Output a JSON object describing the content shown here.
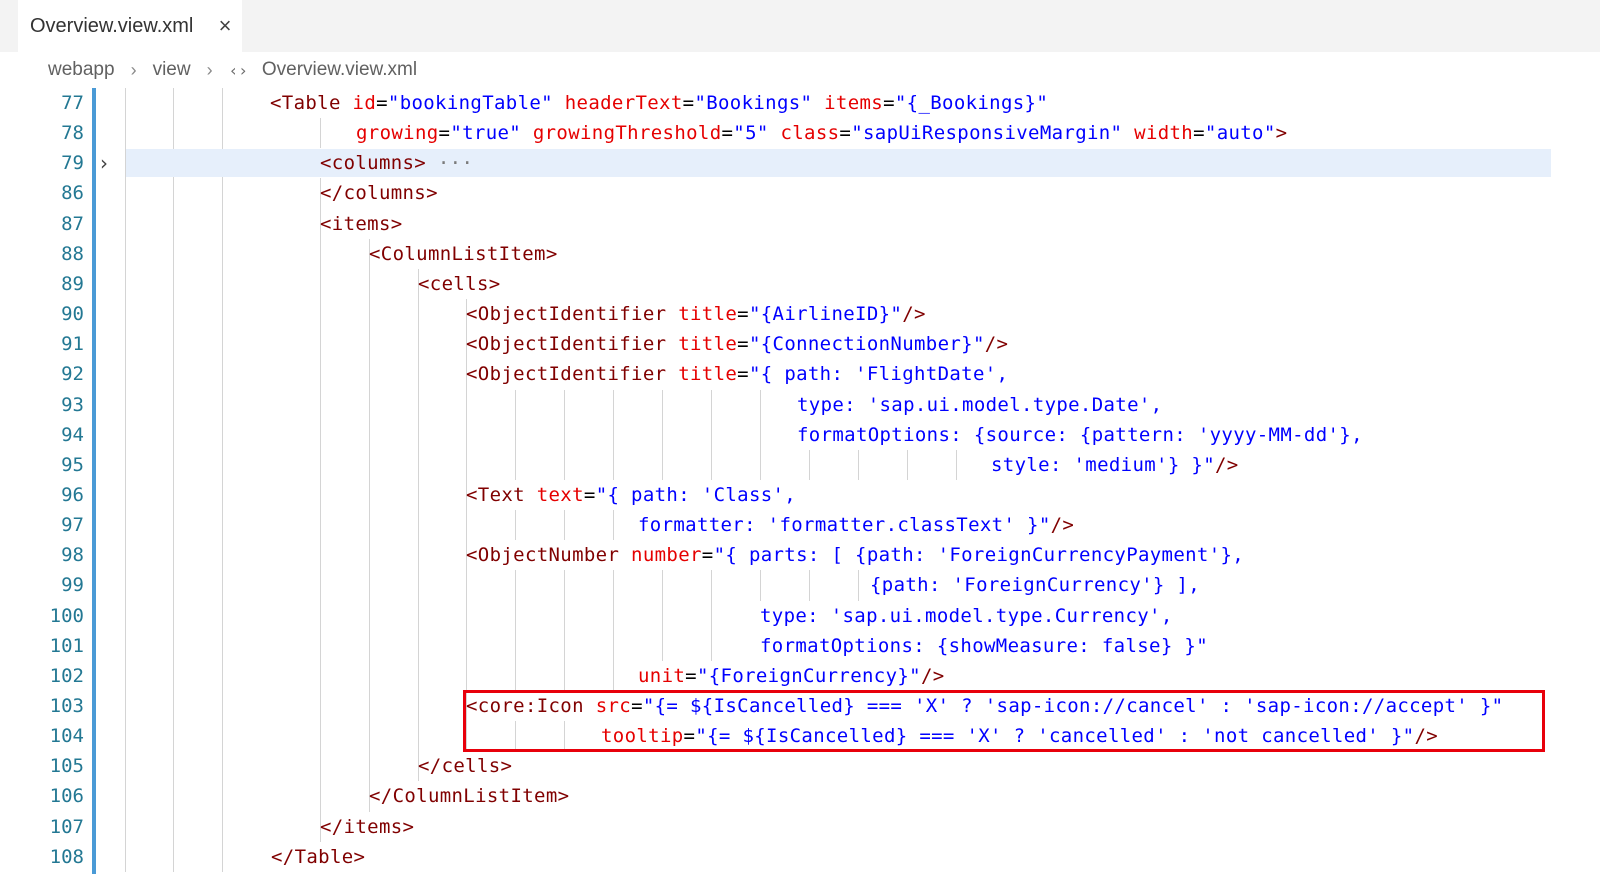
{
  "tab": {
    "title": "Overview.view.xml",
    "close_glyph": "×",
    "close_icon": "close-icon"
  },
  "breadcrumb": {
    "items": [
      "webapp",
      "view",
      "Overview.view.xml"
    ],
    "separator_glyph": "›",
    "file_icon": "xml-icon",
    "file_icon_glyph": "‹›"
  },
  "fold_glyph": "›",
  "colors": {
    "tag": "#800000",
    "attribute": "#e50000",
    "value": "#0000ff",
    "line_number": "#237893",
    "highlight_box": "#e8000b",
    "gutter_bar": "#4a9ad6"
  },
  "code_lines": [
    {
      "n": "77",
      "segs": [
        [
          "tag",
          "<Table "
        ],
        [
          "attr",
          "id"
        ],
        [
          "plain",
          "="
        ],
        [
          "val",
          "\"bookingTable\""
        ],
        [
          "plain",
          " "
        ],
        [
          "attr",
          "headerText"
        ],
        [
          "plain",
          "="
        ],
        [
          "val",
          "\"Bookings\""
        ],
        [
          "plain",
          " "
        ],
        [
          "attr",
          "items"
        ],
        [
          "plain",
          "="
        ],
        [
          "val",
          "\"{_Bookings}\""
        ]
      ]
    },
    {
      "n": "78",
      "segs": [
        [
          "attr",
          "growing"
        ],
        [
          "plain",
          "="
        ],
        [
          "val",
          "\"true\""
        ],
        [
          "plain",
          " "
        ],
        [
          "attr",
          "growingThreshold"
        ],
        [
          "plain",
          "="
        ],
        [
          "val",
          "\"5\""
        ],
        [
          "plain",
          " "
        ],
        [
          "attr",
          "class"
        ],
        [
          "plain",
          "="
        ],
        [
          "val",
          "\"sapUiResponsiveMargin\""
        ],
        [
          "plain",
          " "
        ],
        [
          "attr",
          "width"
        ],
        [
          "plain",
          "="
        ],
        [
          "val",
          "\"auto\""
        ],
        [
          "tag",
          ">"
        ]
      ]
    },
    {
      "n": "79",
      "segs": [
        [
          "tag",
          "<columns>"
        ],
        [
          "fold-dots",
          " ···"
        ]
      ]
    },
    {
      "n": "86",
      "segs": [
        [
          "tag",
          "</columns>"
        ]
      ]
    },
    {
      "n": "87",
      "segs": [
        [
          "tag",
          "<items>"
        ]
      ]
    },
    {
      "n": "88",
      "segs": [
        [
          "tag",
          "<ColumnListItem>"
        ]
      ]
    },
    {
      "n": "89",
      "segs": [
        [
          "tag",
          "<cells>"
        ]
      ]
    },
    {
      "n": "90",
      "segs": [
        [
          "tag",
          "<ObjectIdentifier "
        ],
        [
          "attr",
          "title"
        ],
        [
          "plain",
          "="
        ],
        [
          "val",
          "\"{AirlineID}\""
        ],
        [
          "tag",
          "/>"
        ]
      ]
    },
    {
      "n": "91",
      "segs": [
        [
          "tag",
          "<ObjectIdentifier "
        ],
        [
          "attr",
          "title"
        ],
        [
          "plain",
          "="
        ],
        [
          "val",
          "\"{ConnectionNumber}\""
        ],
        [
          "tag",
          "/>"
        ]
      ]
    },
    {
      "n": "92",
      "segs": [
        [
          "tag",
          "<ObjectIdentifier "
        ],
        [
          "attr",
          "title"
        ],
        [
          "plain",
          "="
        ],
        [
          "val",
          "\"{ path: 'FlightDate',"
        ]
      ]
    },
    {
      "n": "93",
      "segs": [
        [
          "val",
          "type: 'sap.ui.model.type.Date',"
        ]
      ]
    },
    {
      "n": "94",
      "segs": [
        [
          "val",
          "formatOptions: {source: {pattern: 'yyyy-MM-dd'},"
        ]
      ]
    },
    {
      "n": "95",
      "segs": [
        [
          "val",
          "style: 'medium'} }\""
        ],
        [
          "tag",
          "/>"
        ]
      ]
    },
    {
      "n": "96",
      "segs": [
        [
          "tag",
          "<Text "
        ],
        [
          "attr",
          "text"
        ],
        [
          "plain",
          "="
        ],
        [
          "val",
          "\"{ path: 'Class',"
        ]
      ]
    },
    {
      "n": "97",
      "segs": [
        [
          "val",
          "formatter: 'formatter.classText' }\""
        ],
        [
          "tag",
          "/>"
        ]
      ]
    },
    {
      "n": "98",
      "segs": [
        [
          "tag",
          "<ObjectNumber "
        ],
        [
          "attr",
          "number"
        ],
        [
          "plain",
          "="
        ],
        [
          "val",
          "\"{ parts: [ {path: 'ForeignCurrencyPayment'},"
        ]
      ]
    },
    {
      "n": "99",
      "segs": [
        [
          "val",
          "{path: 'ForeignCurrency'} ],"
        ]
      ]
    },
    {
      "n": "100",
      "segs": [
        [
          "val",
          "type: 'sap.ui.model.type.Currency',"
        ]
      ]
    },
    {
      "n": "101",
      "segs": [
        [
          "val",
          "formatOptions: {showMeasure: false} }\""
        ]
      ]
    },
    {
      "n": "102",
      "segs": [
        [
          "attr",
          "unit"
        ],
        [
          "plain",
          "="
        ],
        [
          "val",
          "\"{ForeignCurrency}\""
        ],
        [
          "tag",
          "/>"
        ]
      ]
    },
    {
      "n": "103",
      "segs": [
        [
          "tag",
          "<core:Icon "
        ],
        [
          "attr",
          "src"
        ],
        [
          "plain",
          "="
        ],
        [
          "val",
          "\"{= ${IsCancelled} === 'X' ? 'sap-icon://cancel' : 'sap-icon://accept' }\""
        ]
      ]
    },
    {
      "n": "104",
      "segs": [
        [
          "attr",
          "tooltip"
        ],
        [
          "plain",
          "="
        ],
        [
          "val",
          "\"{= ${IsCancelled} === 'X' ? 'cancelled' : 'not cancelled' }\""
        ],
        [
          "tag",
          "/>"
        ]
      ]
    },
    {
      "n": "105",
      "segs": [
        [
          "tag",
          "</cells>"
        ]
      ]
    },
    {
      "n": "106",
      "segs": [
        [
          "tag",
          "</ColumnListItem>"
        ]
      ]
    },
    {
      "n": "107",
      "segs": [
        [
          "tag",
          "</items>"
        ]
      ]
    },
    {
      "n": "108",
      "segs": [
        [
          "tag",
          "</Table>"
        ]
      ]
    }
  ]
}
